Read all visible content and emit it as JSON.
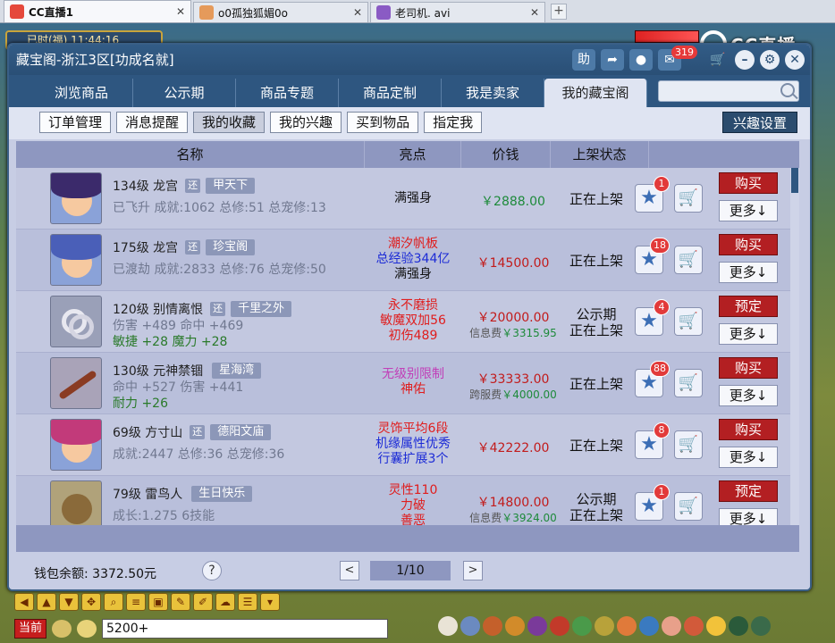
{
  "browser_tabs": [
    {
      "title": "CC直播1",
      "active": true
    },
    {
      "title": "o0孤独狐媚0o",
      "active": false
    },
    {
      "title": "老司机. avi",
      "active": false
    }
  ],
  "clock_text": "已时(福) 11:44:16",
  "cc_logo": "CC直播",
  "window": {
    "title": "藏宝阁-浙江3区[功成名就]",
    "help_char": "助",
    "msg_count": "319"
  },
  "nav_tabs": [
    "浏览商品",
    "公示期",
    "商品专题",
    "商品定制",
    "我是卖家",
    "我的藏宝阁"
  ],
  "sub_tabs": [
    "订单管理",
    "消息提醒",
    "我的收藏",
    "我的兴趣",
    "买到物品",
    "指定我"
  ],
  "interest_button": "兴趣设置",
  "columns": {
    "name": "名称",
    "highlight": "亮点",
    "price": "价钱",
    "status": "上架状态"
  },
  "badge_huan": "还",
  "rows": [
    {
      "level_name": "134级  龙宫",
      "server": "甲天下",
      "line2": "已飞升 成就:1062 总修:51 总宠修:13",
      "line3": "",
      "highlights": [
        {
          "text": "满强身",
          "color": "#111111"
        }
      ],
      "price": "￥2888.00",
      "price_style": "green",
      "fee": "",
      "fee_value": "",
      "status": [
        "正在上架"
      ],
      "fav_count": "1",
      "action": "购买",
      "more": "更多↓"
    },
    {
      "level_name": "175级  龙宫",
      "server": "珍宝阁",
      "line2": "已渡劫 成就:2833 总修:76 总宠修:50",
      "line3": "",
      "highlights": [
        {
          "text": "潮汐帆板",
          "color": "#e01d1d"
        },
        {
          "text": "总经验344亿",
          "color": "#1c2bd6"
        },
        {
          "text": "满强身",
          "color": "#111111"
        }
      ],
      "price": "￥14500.00",
      "price_style": "main",
      "fee": "",
      "fee_value": "",
      "status": [
        "正在上架"
      ],
      "fav_count": "18",
      "action": "购买",
      "more": "更多↓"
    },
    {
      "level_name": "120级  别情离恨",
      "server": "千里之外",
      "line2": "伤害 +489 命中 +469",
      "line3": "敏捷 +28 魔力 +28",
      "highlights": [
        {
          "text": "永不磨损",
          "color": "#e01d1d"
        },
        {
          "text": "敏魔双加56",
          "color": "#e01d1d"
        },
        {
          "text": "初伤489",
          "color": "#e01d1d"
        }
      ],
      "price": "￥20000.00",
      "price_style": "main",
      "fee": "信息费",
      "fee_value": "￥3315.95",
      "status": [
        "公示期",
        "正在上架"
      ],
      "fav_count": "4",
      "action": "预定",
      "more": "更多↓"
    },
    {
      "level_name": "130级  元神禁锢",
      "server": "星海湾",
      "line2": "命中 +527 伤害 +441",
      "line3": "耐力 +26",
      "highlights": [
        {
          "text": "无级别限制",
          "color": "#c13fb8"
        },
        {
          "text": "神佑",
          "color": "#e01d1d"
        }
      ],
      "price": "￥33333.00",
      "price_style": "main",
      "fee": "跨服费",
      "fee_value": "￥4000.00",
      "status": [
        "正在上架"
      ],
      "fav_count": "88",
      "action": "购买",
      "more": "更多↓"
    },
    {
      "level_name": "69级  方寸山",
      "server": "德阳文庙",
      "line2": "成就:2447 总修:36 总宠修:36",
      "line3": "",
      "highlights": [
        {
          "text": "灵饰平均6段",
          "color": "#e01d1d"
        },
        {
          "text": "机缘属性优秀",
          "color": "#1c2bd6"
        },
        {
          "text": "行囊扩展3个",
          "color": "#1c2bd6"
        }
      ],
      "price": "￥42222.00",
      "price_style": "main",
      "fee": "",
      "fee_value": "",
      "status": [
        "正在上架"
      ],
      "fav_count": "8",
      "action": "购买",
      "more": "更多↓"
    },
    {
      "level_name": "79级  雷鸟人",
      "server": "生日快乐",
      "line2": "成长:1.275 6技能",
      "line3": "",
      "highlights": [
        {
          "text": "灵性110",
          "color": "#e01d1d"
        },
        {
          "text": "力破",
          "color": "#e01d1d"
        },
        {
          "text": "善恶",
          "color": "#e01d1d"
        }
      ],
      "price": "￥14800.00",
      "price_style": "main",
      "fee": "信息费",
      "fee_value": "￥3924.00",
      "status": [
        "公示期",
        "正在上架"
      ],
      "fav_count": "1",
      "action": "预定",
      "more": "更多↓"
    }
  ],
  "wallet": "钱包余额: 3372.50元",
  "help": "?",
  "pager": {
    "prev": "<",
    "info": "1/10",
    "next": ">"
  },
  "chat": {
    "channel": "当前",
    "input": "5200+"
  }
}
